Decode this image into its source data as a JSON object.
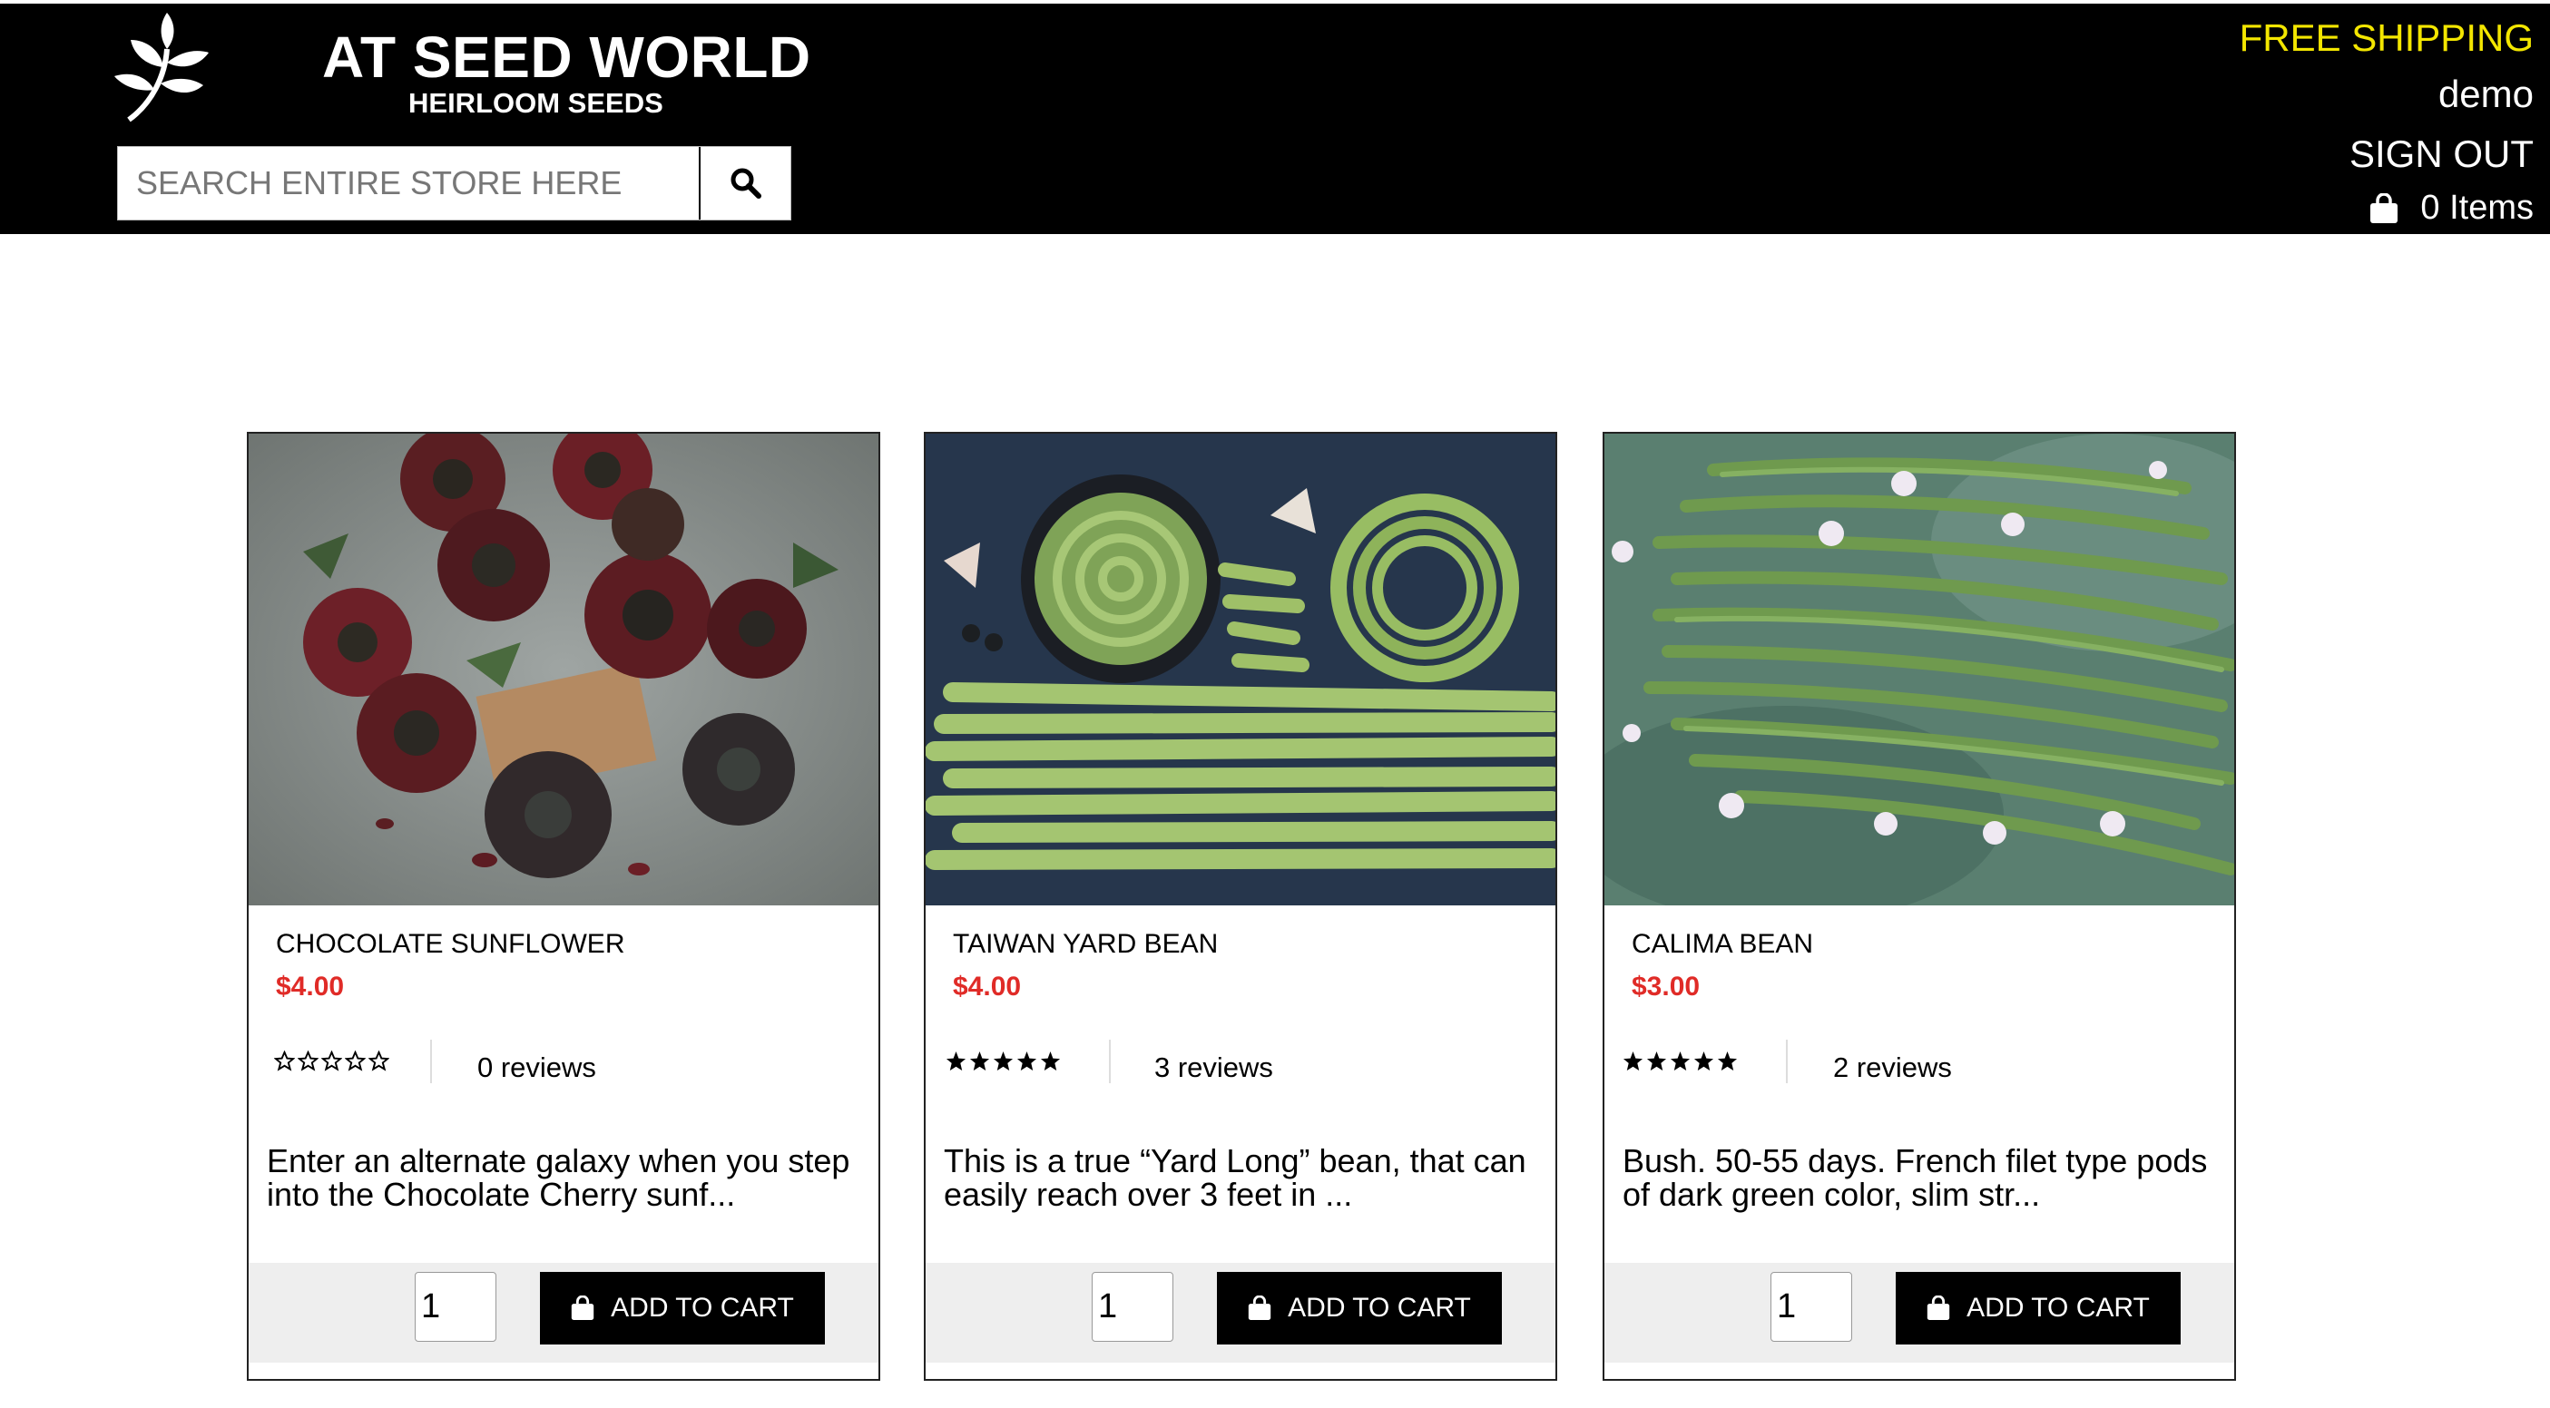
{
  "header": {
    "brand_title": "AT SEED WORLD",
    "brand_subtitle": "HEIRLOOM SEEDS",
    "logo_icon": "leaf-branch-icon",
    "search_placeholder": "SEARCH ENTIRE STORE HERE",
    "search_icon": "search-icon",
    "free_shipping": "FREE SHIPPING",
    "username": "demo",
    "sign_out": "SIGN OUT",
    "cart_icon": "shopping-bag-icon",
    "cart_count": "0 Items"
  },
  "colors": {
    "topbar_bg": "#000000",
    "free_shipping": "#f3e600",
    "price": "#e02b27",
    "button_bg": "#000000",
    "card_footer_bg": "#eeeeee"
  },
  "products": [
    {
      "name": "CHOCOLATE SUNFLOWER",
      "price": "$4.00",
      "rating": 0,
      "reviews": "0 reviews",
      "description": "Enter an alternate galaxy when you step into the Chocolate Cherry sunf...",
      "qty": "1",
      "add_to_cart": "ADD TO CART"
    },
    {
      "name": "TAIWAN YARD BEAN",
      "price": "$4.00",
      "rating": 5,
      "reviews": "3 reviews",
      "description": "This is a true “Yard Long” bean, that can easily reach over 3 feet in ...",
      "qty": "1",
      "add_to_cart": "ADD TO CART"
    },
    {
      "name": "CALIMA BEAN",
      "price": "$3.00",
      "rating": 5,
      "reviews": "2 reviews",
      "description": "Bush. 50-55 days. French filet type pods of dark green color, slim str...",
      "qty": "1",
      "add_to_cart": "ADD TO CART"
    }
  ]
}
